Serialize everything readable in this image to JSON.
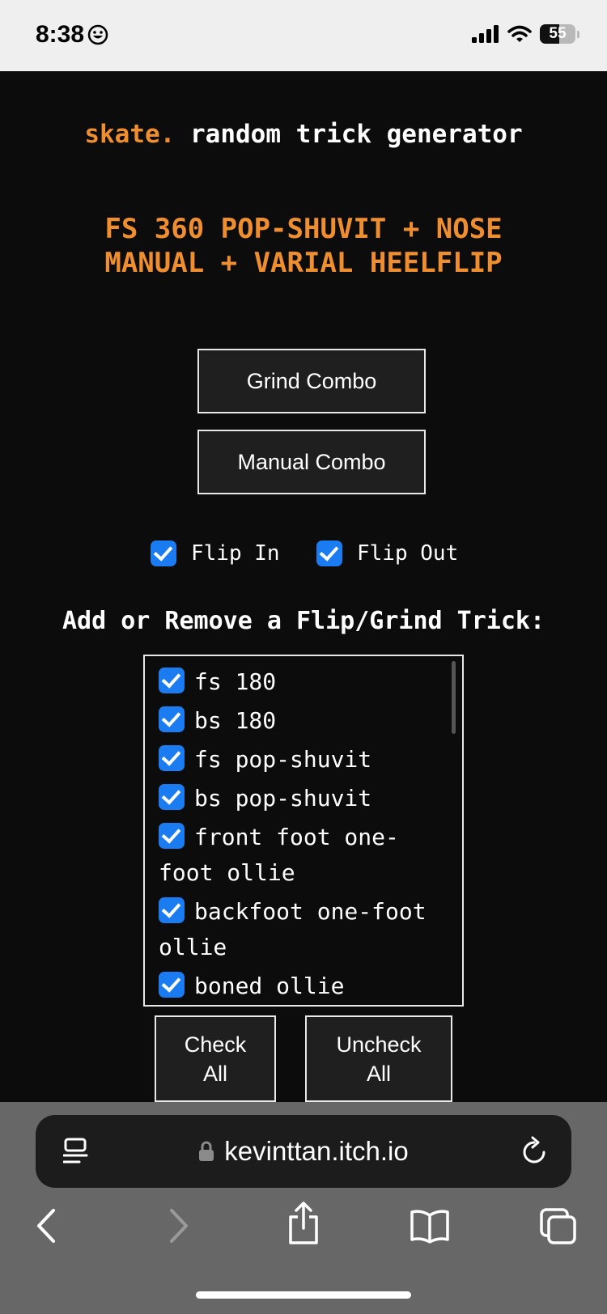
{
  "status": {
    "time": "8:38",
    "battery": "55",
    "battery_level": 0.55
  },
  "header": {
    "brand": "skate.",
    "title": "random trick generator"
  },
  "result": {
    "text": "FS 360 POP-SHUVIT + NOSE MANUAL + VARIAL HEELFLIP"
  },
  "buttons": {
    "grind": "Grind Combo",
    "manual": "Manual Combo",
    "check_all": "Check All",
    "uncheck_all": "Uncheck All"
  },
  "options": [
    {
      "label": "Flip In",
      "checked": true
    },
    {
      "label": "Flip Out",
      "checked": true
    }
  ],
  "tricks": {
    "heading": "Add or Remove a Flip/Grind Trick:",
    "items": [
      {
        "label": "fs 180",
        "checked": true
      },
      {
        "label": "bs 180",
        "checked": true
      },
      {
        "label": "fs pop-shuvit",
        "checked": true
      },
      {
        "label": "bs pop-shuvit",
        "checked": true
      },
      {
        "label": "front foot one-foot ollie",
        "checked": true
      },
      {
        "label": "backfoot one-foot ollie",
        "checked": true
      },
      {
        "label": "boned ollie",
        "checked": true
      }
    ]
  },
  "browser": {
    "url": "kevinttan.itch.io",
    "icons": [
      "reader-icon",
      "lock-icon",
      "reload-icon",
      "back-icon",
      "forward-icon",
      "share-icon",
      "bookmarks-icon",
      "tabs-icon"
    ]
  }
}
